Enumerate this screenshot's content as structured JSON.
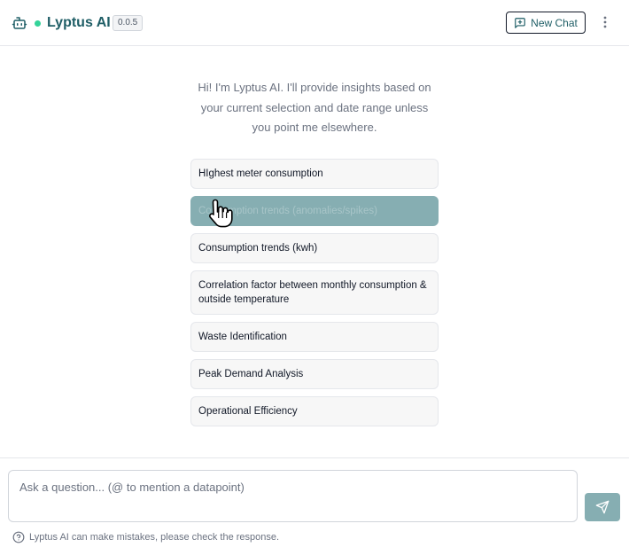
{
  "header": {
    "title": "Lyptus AI",
    "version": "0.0.5",
    "new_chat_label": "New Chat",
    "status_color": "#34d399",
    "brand_color": "#1f5e66"
  },
  "intro": {
    "text": "Hi! I'm Lyptus AI. I'll provide insights based on your current selection and date range unless you point me elsewhere."
  },
  "suggestions": [
    {
      "label": "HIghest meter consumption",
      "active": false
    },
    {
      "label": "Consumption trends (anomalies/spikes)",
      "active": true
    },
    {
      "label": "Consumption trends (kwh)",
      "active": false
    },
    {
      "label": "Correlation factor between monthly consumption & outside temperature",
      "active": false
    },
    {
      "label": "Waste Identification",
      "active": false
    },
    {
      "label": "Peak Demand Analysis",
      "active": false
    },
    {
      "label": "Operational Efficiency",
      "active": false
    }
  ],
  "input": {
    "placeholder": "Ask a question... (@ to mention a datapoint)",
    "value": ""
  },
  "footer": {
    "disclaimer": "Lyptus AI can make mistakes, please check the response."
  },
  "icons": {
    "bot": "robot-icon",
    "new_chat": "chat-plus-icon",
    "more": "more-vertical-icon",
    "send": "send-icon",
    "help": "help-circle-icon",
    "cursor": "hand-pointer-icon"
  },
  "accent_color": "#86aeb2"
}
